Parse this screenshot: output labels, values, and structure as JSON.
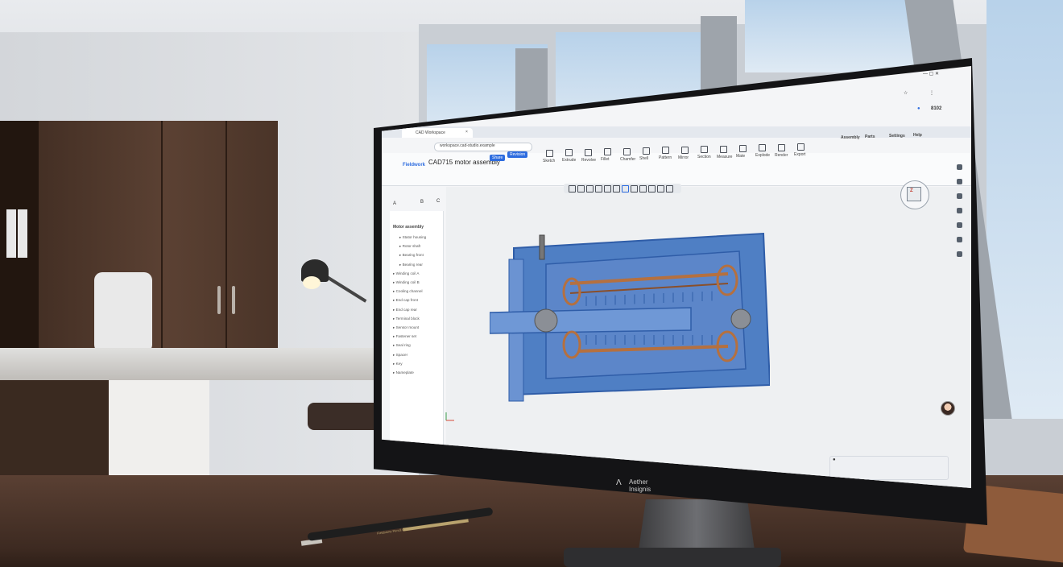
{
  "monitor_brand": {
    "line1": "Aether",
    "line2": "Insignis"
  },
  "pen_text": "Fieldstone Pencil Co.",
  "browser": {
    "tab_title": "CAD Workspace",
    "url": "workspace.cad-studio.example",
    "user_count": "8102"
  },
  "app": {
    "logo": "Fieldwork",
    "document_title": "CAD715 motor assembly",
    "share_button": "Share",
    "revision_button": "Revision",
    "toolbar_labels": [
      "Sketch",
      "Extrude",
      "Revolve",
      "Fillet",
      "Chamfer",
      "Shell",
      "Pattern",
      "Mirror",
      "Section",
      "Measure",
      "Mate",
      "Explode",
      "Render",
      "Export"
    ],
    "right_toolbar": [
      "Assembly",
      "Parts",
      "Settings",
      "Help"
    ],
    "sidebar_tabs": [
      "A",
      "B",
      "C"
    ]
  },
  "tree": {
    "root": "Motor assembly",
    "items": [
      "Stator housing",
      "Rotor shaft",
      "Bearing front",
      "Bearing rear",
      "Winding coil A",
      "Winding coil B",
      "Cooling channel",
      "End cap front",
      "End cap rear",
      "Terminal block",
      "Sensor mount",
      "Fastener set",
      "Seal ring",
      "Spacer",
      "Key",
      "Nameplate"
    ]
  },
  "colors": {
    "part_blue": "#4f7fc4",
    "part_dark": "#2f5da8",
    "copper": "#b5703f",
    "accent": "#2d6cdf"
  }
}
